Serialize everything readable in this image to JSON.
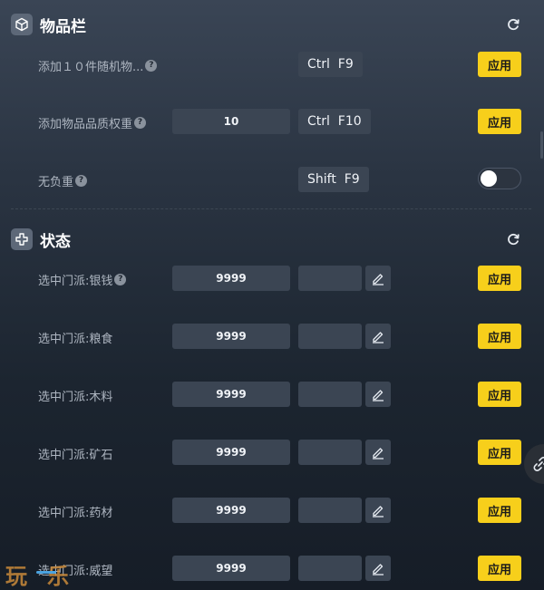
{
  "sections": {
    "items": {
      "title": "物品栏",
      "icon": "cube-icon",
      "refresh_icon": "refresh-icon"
    },
    "status": {
      "title": "状态",
      "icon": "cross-shape-icon",
      "refresh_icon": "refresh-icon"
    }
  },
  "items_rows": [
    {
      "label": "添加１０件随机物...",
      "help": "?",
      "hotkey": "Ctrl  F9",
      "action": "应用"
    },
    {
      "label": "添加物品品质权重",
      "help": "?",
      "value": "10",
      "hotkey": "Ctrl  F10",
      "action": "应用"
    },
    {
      "label": "无负重",
      "help": "?",
      "hotkey": "Shift  F9",
      "toggle_on": false
    }
  ],
  "status_rows": [
    {
      "label": "选中门派:银钱",
      "help": "?",
      "value": "9999",
      "action": "应用"
    },
    {
      "label": "选中门派:粮食",
      "value": "9999",
      "action": "应用"
    },
    {
      "label": "选中门派:木料",
      "value": "9999",
      "action": "应用"
    },
    {
      "label": "选中门派:矿石",
      "value": "9999",
      "action": "应用"
    },
    {
      "label": "选中门派:药材",
      "value": "9999",
      "action": "应用"
    },
    {
      "label": "选中门派:威望",
      "value": "9999",
      "action": "应用"
    }
  ],
  "watermark": {
    "text": "玩乐"
  },
  "colors": {
    "accent": "#f7cf1b",
    "panel": "#3b4553"
  }
}
